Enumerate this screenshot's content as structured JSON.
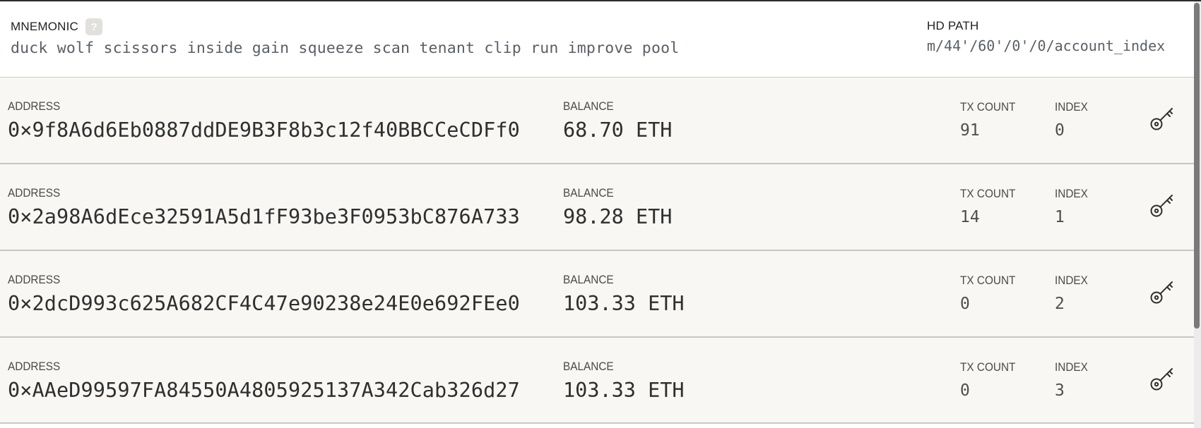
{
  "header": {
    "mnemonic_label": "MNEMONIC",
    "help_glyph": "?",
    "mnemonic": "duck wolf scissors inside gain squeeze scan tenant clip run improve pool",
    "hd_path_label": "HD PATH",
    "hd_path": "m/44'/60'/0'/0/account_index"
  },
  "labels": {
    "address": "ADDRESS",
    "balance": "BALANCE",
    "tx_count": "TX COUNT",
    "index": "INDEX"
  },
  "accounts": [
    {
      "address": "0×9f8A6d6Eb0887ddDE9B3F8b3c12f40BBCCeCDFf0",
      "balance": "68.70 ETH",
      "tx_count": "91",
      "index": "0"
    },
    {
      "address": "0×2a98A6dEce32591A5d1fF93be3F0953bC876A733",
      "balance": "98.28 ETH",
      "tx_count": "14",
      "index": "1"
    },
    {
      "address": "0×2dcD993c625A682CF4C47e90238e24E0e692FEe0",
      "balance": "103.33 ETH",
      "tx_count": "0",
      "index": "2"
    },
    {
      "address": "0×AAeD99597FA84550A4805925137A342Cab326d27",
      "balance": "103.33 ETH",
      "tx_count": "0",
      "index": "3"
    }
  ],
  "icons": {
    "help": "help-icon",
    "key": "key-icon"
  },
  "colors": {
    "row_background": "#f8f7f4",
    "divider": "#c9c7c2",
    "mono_text": "#5a5e66"
  }
}
